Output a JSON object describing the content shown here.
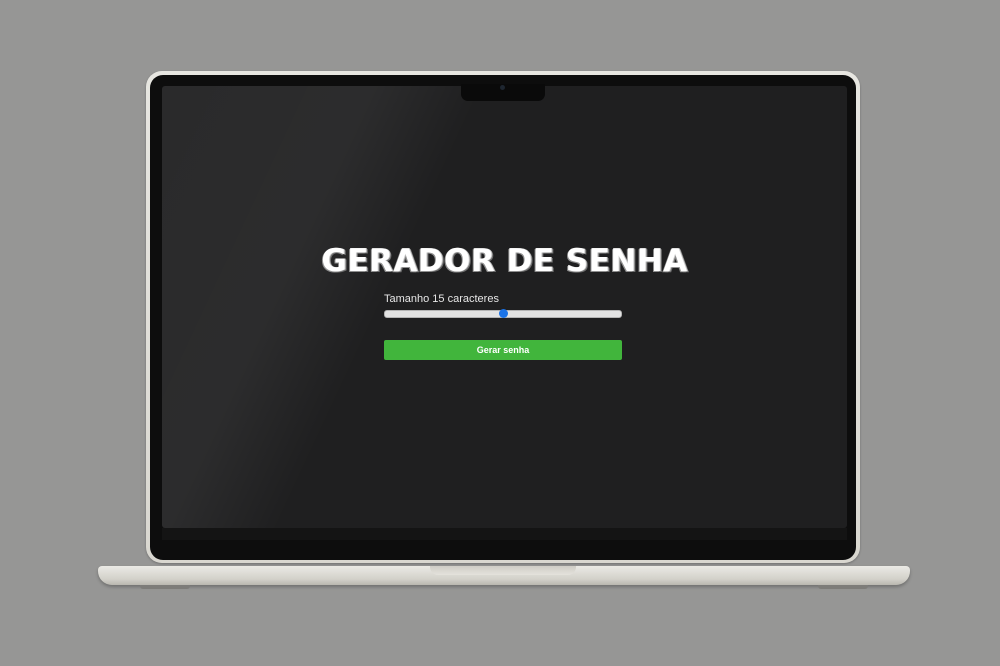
{
  "app": {
    "title": "GERADOR DE SENHA",
    "length_label": "Tamanho 15 caracteres",
    "length_slider": {
      "value": 15,
      "fraction": 0.5
    },
    "generate_button_label": "Gerar senha"
  },
  "colors": {
    "background": "#969695",
    "screen": "#1f1f20",
    "button": "#41b53c",
    "slider_thumb": "#1a73e8",
    "slider_track": "#e3e3e3",
    "title_text": "#ffffff"
  },
  "icons": {
    "camera": "webcam-dot"
  }
}
